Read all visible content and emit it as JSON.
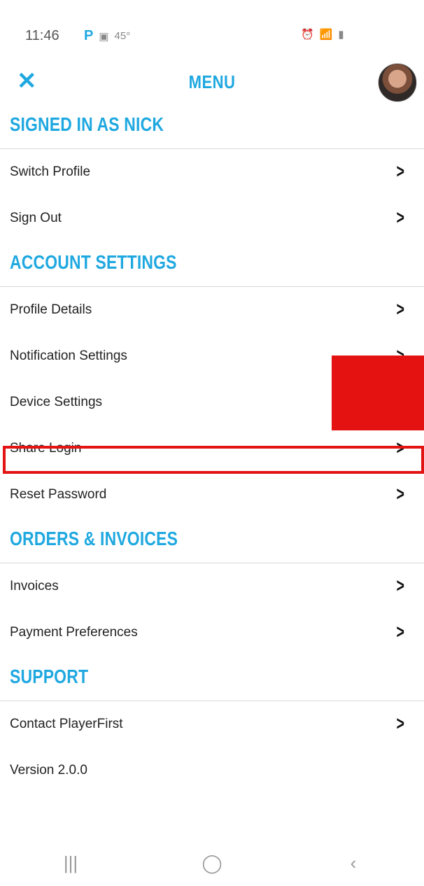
{
  "status": {
    "time": "11:46",
    "left_icons": [
      "P",
      "▣",
      "45°"
    ],
    "right_icons": [
      "⏰",
      "📶",
      "▮"
    ]
  },
  "header": {
    "close_glyph": "✕",
    "title": "MENU"
  },
  "sections": [
    {
      "title": "SIGNED IN AS NICK",
      "items": [
        "Switch Profile",
        "Sign Out"
      ]
    },
    {
      "title": "ACCOUNT SETTINGS",
      "items": [
        "Profile Details",
        "Notification Settings",
        "Device Settings",
        "Share Login",
        "Reset Password"
      ]
    },
    {
      "title": "ORDERS & INVOICES",
      "items": [
        "Invoices",
        "Payment Preferences"
      ]
    },
    {
      "title": "SUPPORT",
      "items": [
        "Contact PlayerFirst"
      ]
    }
  ],
  "version": "Version 2.0.0",
  "navbar": {
    "recent": "|||",
    "home": "◯",
    "back": "‹"
  },
  "colors": {
    "accent": "#1fa8e0",
    "highlight": "#e21414"
  }
}
